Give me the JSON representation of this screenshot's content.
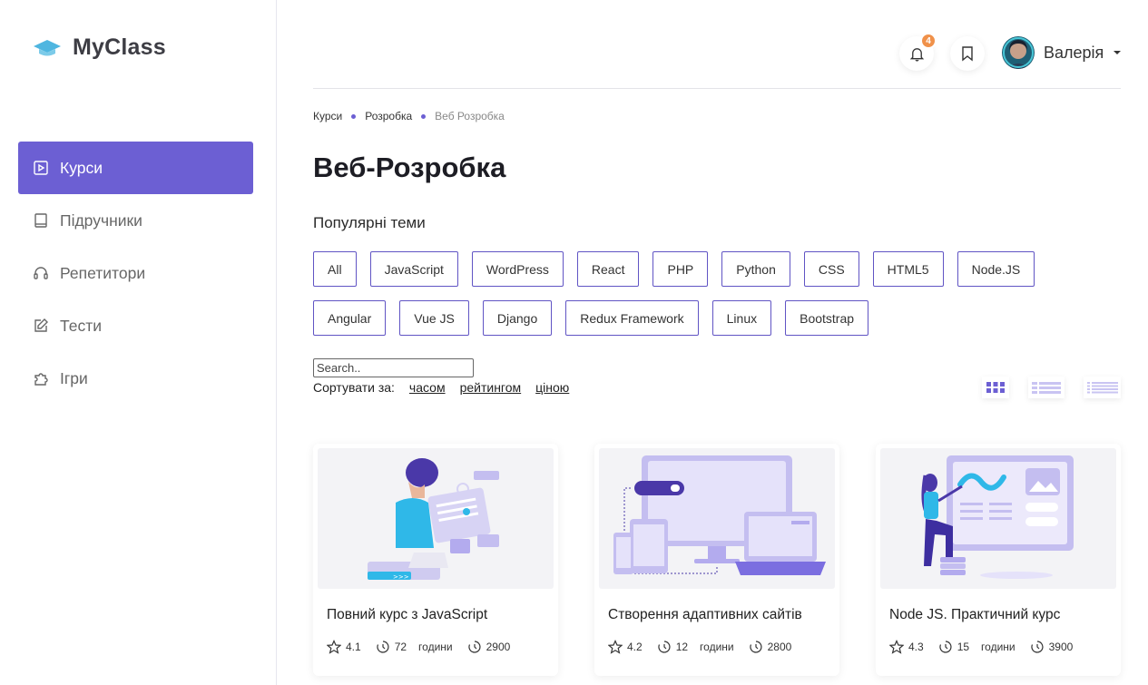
{
  "sidebar": {
    "logo_text": "MyClass",
    "items": [
      {
        "label": "Курси",
        "icon": "play-square-icon",
        "active": true
      },
      {
        "label": "Підручники",
        "icon": "book-icon",
        "active": false
      },
      {
        "label": "Репетитори",
        "icon": "headphones-icon",
        "active": false
      },
      {
        "label": "Тести",
        "icon": "edit-icon",
        "active": false
      },
      {
        "label": "Ігри",
        "icon": "puzzle-icon",
        "active": false
      }
    ]
  },
  "header": {
    "notification_count": "4",
    "user_name": "Валерія"
  },
  "breadcrumb": [
    "Курси",
    "Розробка",
    "Веб Розробка"
  ],
  "page_title": "Веб-Розробка",
  "popular_title": "Популярні теми",
  "tags_row1": [
    "All",
    "JavaScript",
    "WordPress",
    "React",
    "PHP",
    "Python",
    "CSS",
    "HTML5",
    "Node.JS"
  ],
  "tags_row2": [
    "Angular",
    "Vue JS",
    "Django",
    "Redux Framework",
    "Linux",
    "Bootstrap"
  ],
  "search": {
    "placeholder": "Search.."
  },
  "sort": {
    "label": "Сортувати за:",
    "options": [
      "часом",
      "рейтингом",
      "ціною"
    ]
  },
  "colors": {
    "accent": "#6c5fd3",
    "badge": "#f0914a"
  },
  "courses": [
    {
      "title": "Повний курс з JavaScript",
      "rating": "4.1",
      "hours": "72",
      "hours_label": "години",
      "views": "2900"
    },
    {
      "title": "Створення адаптивних сайтів",
      "rating": "4.2",
      "hours": "12",
      "hours_label": "години",
      "views": "2800"
    },
    {
      "title": "Node JS. Практичний курс",
      "rating": "4.3",
      "hours": "15",
      "hours_label": "години",
      "views": "3900"
    }
  ]
}
